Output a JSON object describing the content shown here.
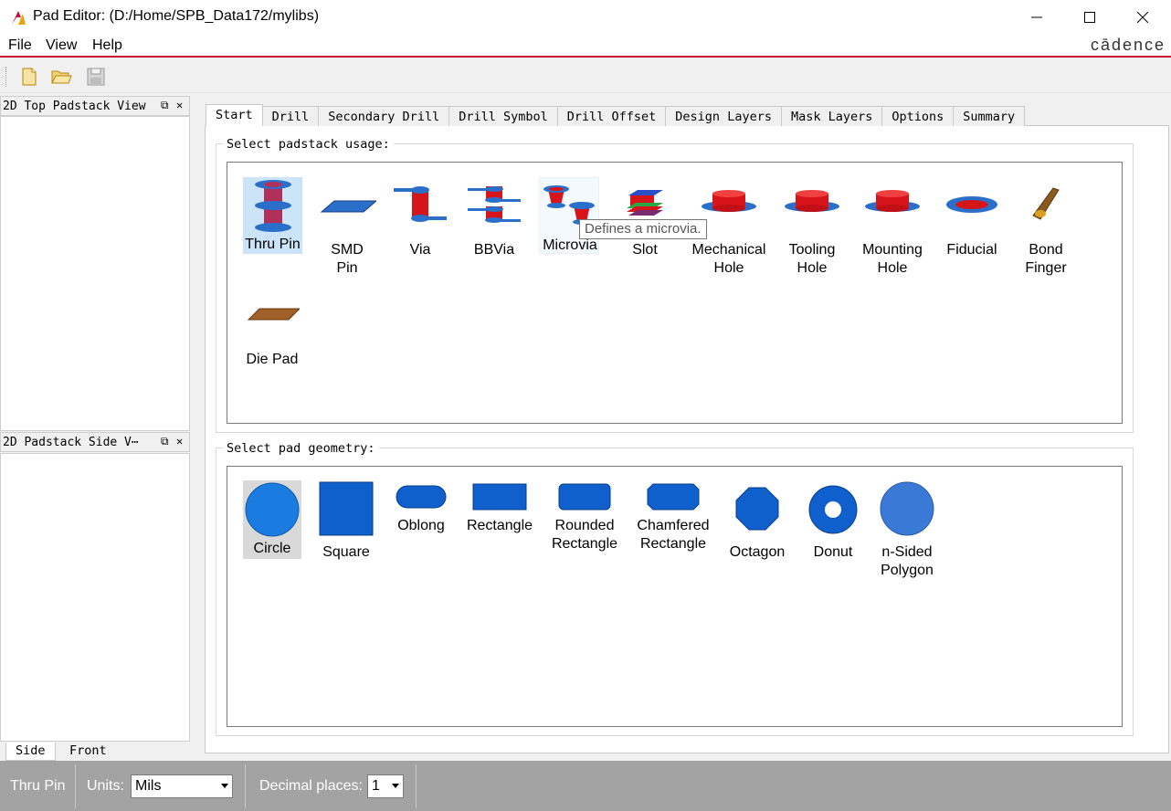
{
  "window": {
    "title": "Pad Editor:  (D:/Home/SPB_Data172/mylibs)"
  },
  "menu": {
    "file": "File",
    "view": "View",
    "help": "Help",
    "brand": "cādence"
  },
  "toolbar": {
    "icons": [
      "new-file-icon",
      "open-folder-icon",
      "save-icon"
    ]
  },
  "docks": {
    "top_view": {
      "title": "2D Top Padstack View"
    },
    "side_view": {
      "title": "2D Padstack Side V⋯"
    },
    "side_tabs": [
      "Side",
      "Front"
    ]
  },
  "tabs": [
    "Start",
    "Drill",
    "Secondary Drill",
    "Drill Symbol",
    "Drill Offset",
    "Design Layers",
    "Mask Layers",
    "Options",
    "Summary"
  ],
  "start": {
    "usage_title": "Select padstack usage:",
    "geometry_title": "Select pad geometry:",
    "usage_items": [
      {
        "label": "Thru Pin",
        "selected": true
      },
      {
        "label": "SMD\nPin"
      },
      {
        "label": "Via"
      },
      {
        "label": "BBVia"
      },
      {
        "label": "Microvia",
        "hovered": true
      },
      {
        "label": "Slot"
      },
      {
        "label": "Mechanical\nHole"
      },
      {
        "label": "Tooling\nHole"
      },
      {
        "label": "Mounting\nHole"
      },
      {
        "label": "Fiducial"
      },
      {
        "label": "Bond\nFinger"
      },
      {
        "label": "Die Pad"
      }
    ],
    "geometry_items": [
      {
        "label": "Circle",
        "selected": true
      },
      {
        "label": "Square"
      },
      {
        "label": "Oblong"
      },
      {
        "label": "Rectangle"
      },
      {
        "label": "Rounded\nRectangle"
      },
      {
        "label": "Chamfered\nRectangle"
      },
      {
        "label": "Octagon"
      },
      {
        "label": "Donut"
      },
      {
        "label": "n-Sided\nPolygon"
      }
    ],
    "tooltip": "Defines a microvia."
  },
  "status": {
    "usage": "Thru Pin",
    "units_label": "Units:",
    "units_value": "Mils",
    "decimal_label": "Decimal places:",
    "decimal_value": "1"
  },
  "colors": {
    "accent": "#c8102e",
    "pad_blue": "#1a6fd1",
    "drill_red": "#d8141b",
    "status_bar": "#a3a3a3"
  }
}
